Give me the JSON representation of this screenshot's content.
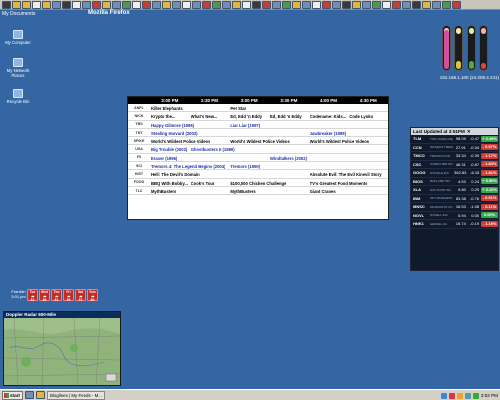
{
  "titlebar": {
    "mydocs": "My Documents",
    "app": "Mozilla Firefox"
  },
  "desktop": {
    "icons": [
      {
        "label": "My Computer",
        "icon": "computer-icon"
      },
      {
        "label": "My Network Places",
        "icon": "network-icon"
      },
      {
        "label": "Recycle Bin",
        "icon": "recycle-bin-icon"
      }
    ]
  },
  "ip": "192.168.1.100 (24.209.4.241)",
  "gauges": [
    {
      "color": "#d64f9c",
      "top": "#f0cae0",
      "level": 0.92
    },
    {
      "color": "#d8c63b",
      "top": "#f2ec9a",
      "level": 0.2
    },
    {
      "color": "#4ca84a",
      "top": "#d9f0a0",
      "level": 0.18
    },
    {
      "color": "#d64a3b",
      "top": "#f5b4a0",
      "level": 0.15
    }
  ],
  "tv": {
    "times": [
      "2:00 PM",
      "2:30 PM",
      "3:00 PM",
      "3:30 PM",
      "4:00 PM",
      "4:30 PM"
    ],
    "rows": [
      {
        "ch": "ANPL",
        "cells": [
          {
            "t": "Killer Elephants",
            "s": 0,
            "l": false
          },
          {
            "t": "Pet Star",
            "s": 2,
            "l": false
          }
        ]
      },
      {
        "ch": "NICK",
        "cells": [
          {
            "t": "Krypto the...",
            "s": 0,
            "l": false
          },
          {
            "t": "What's New...",
            "s": 1,
            "l": false
          },
          {
            "t": "Ed, Edd 'n Eddy",
            "s": 2,
            "l": false
          },
          {
            "t": "Ed, Edd 'n Eddy",
            "s": 3,
            "l": false
          },
          {
            "t": "Codename: Kids...",
            "s": 4,
            "l": false
          },
          {
            "t": "Code Lyoko",
            "s": 5,
            "l": false
          }
        ]
      },
      {
        "ch": "TBS",
        "cells": [
          {
            "t": "Happy Gilmore (1996)",
            "s": 0,
            "l": true
          },
          {
            "t": "Liar Liar (1997)",
            "s": 2,
            "l": true
          }
        ]
      },
      {
        "ch": "TNT",
        "cells": [
          {
            "t": "Stealing Harvard (2002)",
            "s": 0,
            "l": true
          },
          {
            "t": "Jawbreaker (1999)",
            "s": 4,
            "l": true
          }
        ]
      },
      {
        "ch": "SPIKE",
        "cells": [
          {
            "t": "World's Wildest Police Videos",
            "s": 0,
            "l": false
          },
          {
            "t": "World's Wildest Police Videos",
            "s": 2,
            "l": false
          },
          {
            "t": "World's Wildest Police Videos",
            "s": 4,
            "l": false
          }
        ]
      },
      {
        "ch": "USA",
        "cells": [
          {
            "t": "Big Trouble (2002)",
            "s": 0,
            "l": true
          },
          {
            "t": "Ghostbusters II (1989)",
            "s": 1,
            "l": true
          }
        ]
      },
      {
        "ch": "FX",
        "cells": [
          {
            "t": "Eraser (1996)",
            "s": 0,
            "l": true
          },
          {
            "t": "Windtalkers (2002)",
            "s": 3,
            "l": true
          }
        ]
      },
      {
        "ch": "SCI",
        "cells": [
          {
            "t": "Tremors 4: The Legend Begins (2004)",
            "s": 0,
            "l": true
          },
          {
            "t": "Tremors (1990)",
            "s": 2,
            "l": true
          }
        ]
      },
      {
        "ch": "HIST",
        "cells": [
          {
            "t": "Hell: The Devil's Domain",
            "s": 0,
            "l": false
          },
          {
            "t": "Absolute Evil: The Evil Kinevil Story",
            "s": 4,
            "l": false
          }
        ]
      },
      {
        "ch": "FOOD",
        "cells": [
          {
            "t": "BBQ With Bobby...",
            "s": 0,
            "l": false
          },
          {
            "t": "Cook's Tour",
            "s": 1,
            "l": false
          },
          {
            "t": "$100,000 Chicken Challenge",
            "s": 2,
            "l": false
          },
          {
            "t": "TV's Greatest Food Moments",
            "s": 4,
            "l": false
          }
        ]
      },
      {
        "ch": "TLC",
        "cells": [
          {
            "t": "MythBusters",
            "s": 0,
            "l": false
          },
          {
            "t": "MythBusters",
            "s": 2,
            "l": false
          },
          {
            "t": "Giant Cranes",
            "s": 4,
            "l": false
          }
        ]
      }
    ]
  },
  "stocks": {
    "header": "Last Updated at 3:51PM",
    "rows": [
      {
        "sym": "TLM",
        "sub": "TOM JONES MEDIA",
        "px": "98.09",
        "ch": "-0.47",
        "pct": "+ 0.49%",
        "up": true
      },
      {
        "sym": "CCN",
        "sub": "INTERACT MEDIA",
        "px": "27.91",
        "ch": "-0.34",
        "pct": "- 0.57%",
        "up": false
      },
      {
        "sym": "TMCO",
        "sub": "TRANSCO INC",
        "px": "33.34",
        "ch": "-0.39",
        "pct": "- 1.17%",
        "up": false
      },
      {
        "sym": "CSC",
        "sub": "COMPUTER SCIENCES",
        "px": "46.31",
        "ch": "-0.87",
        "pct": "- 1.83%",
        "up": false
      },
      {
        "sym": "GOOG",
        "sub": "GOOGLE INC",
        "px": "362.83",
        "ch": "-6.15",
        "pct": "- 1.81%",
        "up": false
      },
      {
        "sym": "BIOS",
        "sub": "BIOS AMP INC",
        "px": "4.53",
        "ch": "0.24",
        "pct": "+ 5.50%",
        "up": true
      },
      {
        "sym": "XLA",
        "sub": "NAT FOOD INC",
        "px": "9.80",
        "ch": "0.29",
        "pct": "+ 3.10%",
        "up": true
      },
      {
        "sym": "IBM",
        "sub": "INTL BUSINESS MAC",
        "px": "83.38",
        "ch": "-0.76",
        "pct": "- 0.91%",
        "up": false
      },
      {
        "sym": "MNSC",
        "sub": "MONSANTO CO",
        "px": "16.53",
        "ch": "-1.08",
        "pct": "- 6.11%",
        "up": false
      },
      {
        "sym": "NOVL",
        "sub": "NOVELL INC",
        "px": "5.94",
        "ch": "0.00",
        "pct": "0.00%",
        "up": true
      },
      {
        "sym": "HNK1",
        "sub": "HENKEL AG",
        "px": "15.74",
        "ch": "-0.19",
        "pct": "- 1.19%",
        "up": false
      }
    ]
  },
  "weather": {
    "city": "Franklin",
    "time": "3:01 pm",
    "days": [
      {
        "name": "Tue",
        "temp": "62"
      },
      {
        "name": "Wed",
        "temp": "58"
      },
      {
        "name": "Thu",
        "temp": "61"
      },
      {
        "name": "Fri",
        "temp": "55"
      },
      {
        "name": "Sat",
        "temp": "57"
      },
      {
        "name": "Sun",
        "temp": "60"
      }
    ]
  },
  "radar": {
    "title": "Doppler Radar 600-Mile"
  },
  "taskbar": {
    "start": "start",
    "tasks": [
      "Bloglines | My Feeds - M..."
    ],
    "clock": "3:02 PM"
  },
  "colors": {
    "desktop": "#3466a3",
    "stock_up": "#3aa64a",
    "stock_down": "#d03a36"
  }
}
